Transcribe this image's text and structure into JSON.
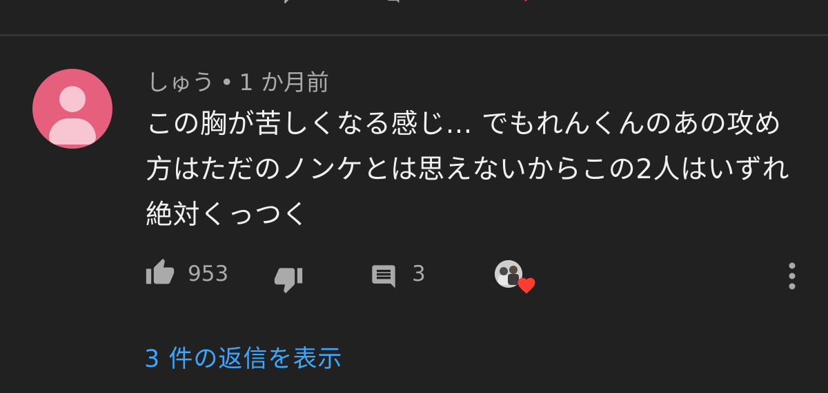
{
  "comment": {
    "author": "しゅう",
    "separator": "•",
    "time": "1 か月前",
    "text": "この胸が苦しくなる感じ… でもれんくんのあの攻め方はただのノンケとは思えないからこの2人はいずれ絶対くっつく",
    "likes": "953",
    "reply_count": "3",
    "view_replies_label": "3 件の返信を表示"
  },
  "colors": {
    "background": "#212121",
    "avatar": "#e6607e",
    "link": "#3ea6ff",
    "heart": "#ff3d2e"
  },
  "icons": {
    "like": "thumbs-up-icon",
    "dislike": "thumbs-down-icon",
    "reply": "comment-icon",
    "heart": "heart-icon",
    "more": "more-vert-icon"
  }
}
